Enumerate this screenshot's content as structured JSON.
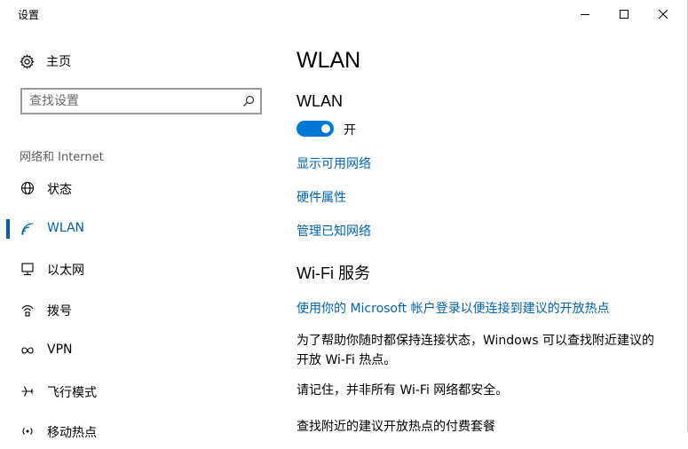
{
  "window": {
    "title": "设置",
    "controls": {
      "minimize": "minimize-icon",
      "maximize": "maximize-icon",
      "close": "close-icon"
    }
  },
  "sidebar": {
    "home_label": "主页",
    "search": {
      "placeholder": "查找设置",
      "value": ""
    },
    "section_heading": "网络和 Internet",
    "items": [
      {
        "label": "状态",
        "icon": "globe-icon",
        "active": false
      },
      {
        "label": "WLAN",
        "icon": "wifi-icon",
        "active": true
      },
      {
        "label": "以太网",
        "icon": "ethernet-icon",
        "active": false
      },
      {
        "label": "拨号",
        "icon": "dialup-icon",
        "active": false
      },
      {
        "label": "VPN",
        "icon": "vpn-icon",
        "active": false
      },
      {
        "label": "飞行模式",
        "icon": "airplane-icon",
        "active": false
      },
      {
        "label": "移动热点",
        "icon": "hotspot-icon",
        "active": false
      }
    ]
  },
  "main": {
    "page_title": "WLAN",
    "wlan_heading": "WLAN",
    "toggle": {
      "state": "on",
      "label": "开"
    },
    "links": {
      "show_networks": "显示可用网络",
      "hardware_properties": "硬件属性",
      "manage_known": "管理已知网络"
    },
    "wifi_services": {
      "heading": "Wi-Fi 服务",
      "ms_account_link": "使用你的 Microsoft 帐户登录以便连接到建议的开放热点",
      "para1": "为了帮助你随时都保持连接状态，Windows 可以查找附近建议的开放 Wi-Fi 热点。",
      "para2": "请记住，并非所有 Wi-Fi 网络都安全。",
      "para3": "查找附近的建议开放热点的付费套餐"
    }
  },
  "colors": {
    "accent": "#0063b1",
    "toggle_on": "#0078d7",
    "section_heading": "#5b5b5b"
  }
}
